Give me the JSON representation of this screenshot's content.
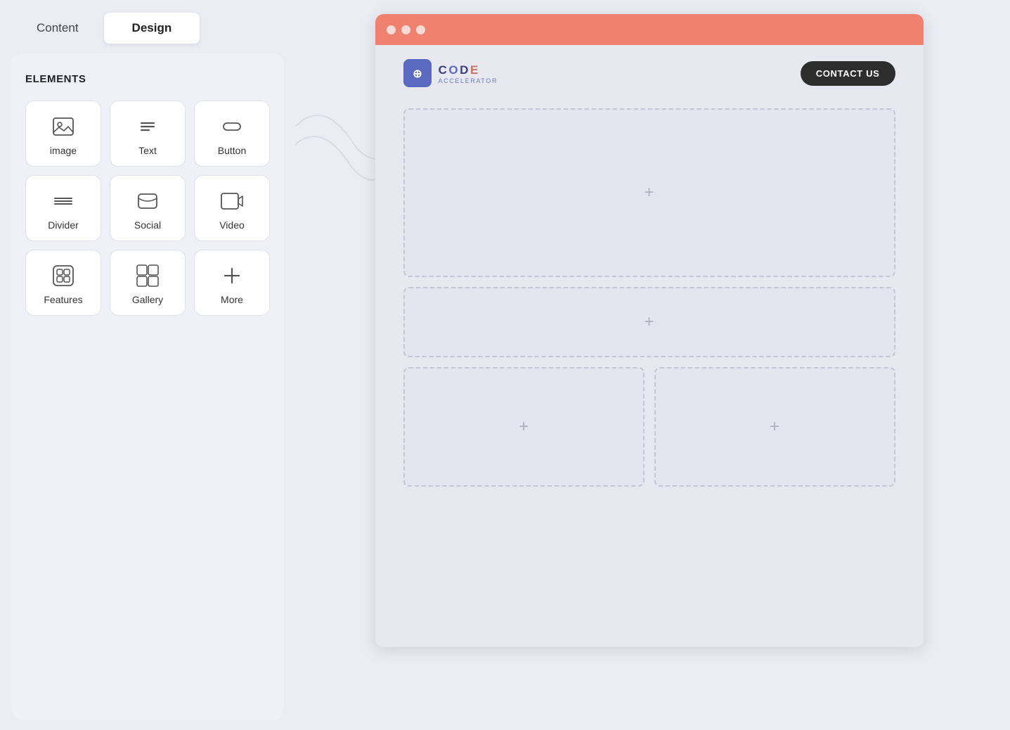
{
  "tabs": {
    "content_label": "Content",
    "design_label": "Design"
  },
  "panel": {
    "elements_title": "ELEMENTS",
    "items": [
      {
        "id": "image",
        "label": "image",
        "icon": "image"
      },
      {
        "id": "text",
        "label": "Text",
        "icon": "text"
      },
      {
        "id": "button",
        "label": "Button",
        "icon": "button"
      },
      {
        "id": "divider",
        "label": "Divider",
        "icon": "divider"
      },
      {
        "id": "social",
        "label": "Social",
        "icon": "social"
      },
      {
        "id": "video",
        "label": "Video",
        "icon": "video"
      },
      {
        "id": "features",
        "label": "Features",
        "icon": "features"
      },
      {
        "id": "gallery",
        "label": "Gallery",
        "icon": "gallery"
      },
      {
        "id": "more",
        "label": "More",
        "icon": "more"
      }
    ]
  },
  "browser": {
    "logo_main": "CODE",
    "logo_sub": "ACCELERATOR",
    "contact_button": "CONTACT US",
    "add_icon": "+",
    "blocks": [
      {
        "id": "block-1",
        "size": "tall"
      },
      {
        "id": "block-2",
        "size": "medium"
      },
      {
        "id": "block-3",
        "size": "half"
      },
      {
        "id": "block-4",
        "size": "half"
      }
    ]
  }
}
